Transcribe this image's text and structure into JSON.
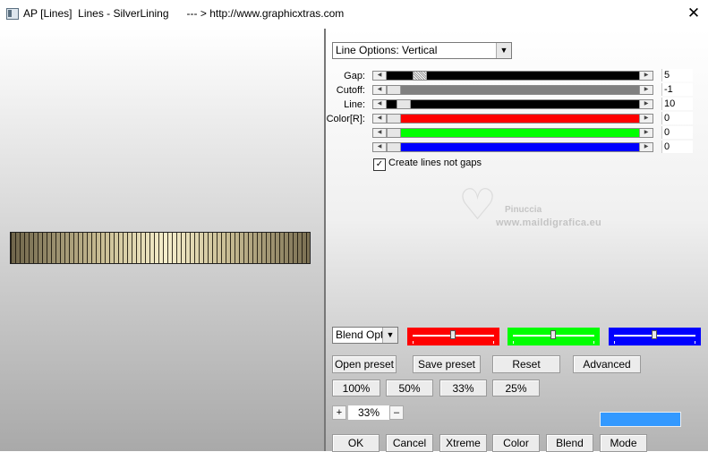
{
  "window": {
    "title": "AP [Lines]  Lines - SilverLining      --- > http://www.graphicxtras.com",
    "close_glyph": "✕"
  },
  "line_options": {
    "selected": "Line Options: Vertical"
  },
  "sliders": [
    {
      "label": "Gap:",
      "value": "5"
    },
    {
      "label": "Cutoff:",
      "value": "-1"
    },
    {
      "label": "Line:",
      "value": "10"
    },
    {
      "label": "Color[R]:",
      "value": "0",
      "color": "#ff0000"
    },
    {
      "label": "",
      "value": "0",
      "color": "#00ff00"
    },
    {
      "label": "",
      "value": "0",
      "color": "#0000ff"
    }
  ],
  "checkbox": {
    "label": "Create lines not gaps",
    "checked": true,
    "mark": "✓"
  },
  "watermark": {
    "name": "Pinuccia",
    "site": "www.maildigrafica.eu"
  },
  "blend_options": {
    "selected": "Blend Optio"
  },
  "color_sliders": [
    {
      "color": "#ff0000",
      "position": 0.5
    },
    {
      "color": "#00ff00",
      "position": 0.5
    },
    {
      "color": "#0000ff",
      "position": 0.5
    }
  ],
  "preset_buttons": [
    "Open preset",
    "Save preset",
    "Reset",
    "Advanced"
  ],
  "zoom_buttons": [
    "100%",
    "50%",
    "33%",
    "25%"
  ],
  "zoom": {
    "minus": "–",
    "plus": "+",
    "value": "33%"
  },
  "swatch_color": "#3399ff",
  "bottom_buttons": [
    "OK",
    "Cancel",
    "Xtreme",
    "Color",
    "Blend",
    "Mode"
  ]
}
